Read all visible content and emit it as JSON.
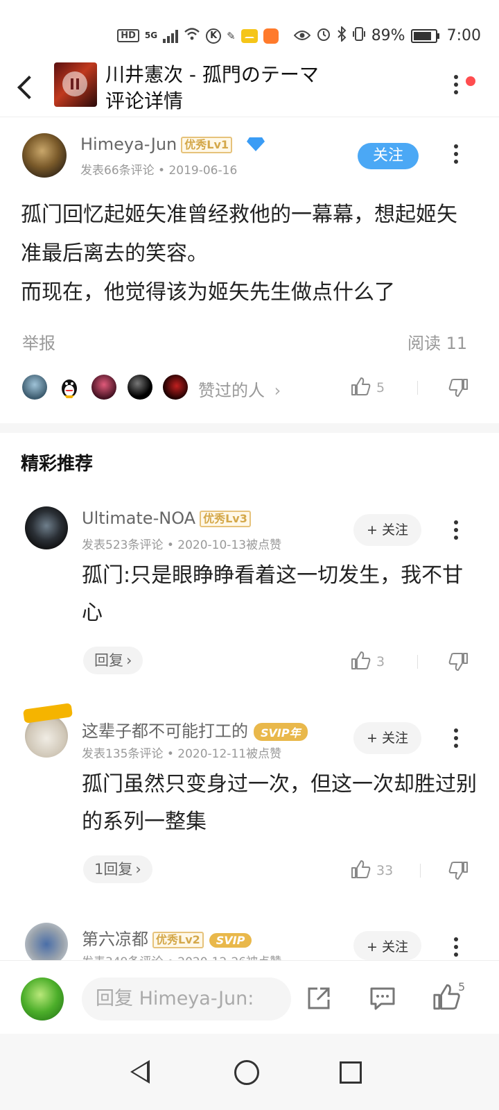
{
  "status_bar": {
    "hd": "HD",
    "network": "5G",
    "battery_pct_text": "89%",
    "battery_level": 0.89,
    "time": "7:00",
    "icons": [
      "hd-icon",
      "signal-icon",
      "wifi-icon",
      "k-icon",
      "app-icon",
      "mail-icon",
      "didi-icon",
      "eye-icon",
      "alarm-icon",
      "bluetooth-icon",
      "vibrate-icon",
      "battery-icon"
    ]
  },
  "header": {
    "song_title": "川井憲次 - 孤門のテーマ",
    "subtitle": "评论详情"
  },
  "main_comment": {
    "username": "Himeya-Jun",
    "level_badge": "优秀Lv1",
    "meta": "发表66条评论 • 2019-06-16",
    "follow_label": "关注",
    "text": "孤门回忆起姬矢准曾经救他的一幕幕，想起姬矢准最后离去的笑容。\n而现在，他觉得该为姬矢先生做点什么了",
    "report_label": "举报",
    "reads_label": "阅读 11",
    "likers_label": "赞过的人",
    "like_count": "5"
  },
  "section_title": "精彩推荐",
  "comments": [
    {
      "username": "Ultimate-NOA",
      "badge": "优秀Lv3",
      "meta": "发表523条评论 • 2020-10-13被点赞",
      "follow_label": "+ 关注",
      "text": "孤门:只是眼睁睁看着这一切发生，我不甘心",
      "reply_label": "回复",
      "like_count": "3"
    },
    {
      "username": "这辈子都不可能打工的",
      "badge": "SVIP年",
      "meta": "发表135条评论 • 2020-12-11被点赞",
      "follow_label": "+ 关注",
      "text": "孤门虽然只变身过一次，但这一次却胜过别的系列一整集",
      "reply_label": "1回复",
      "like_count": "33"
    },
    {
      "username": "第六凉都",
      "badge": "优秀Lv2",
      "badge2": "SVIP",
      "meta": "发表349条评论 • 2020-12-26被点赞",
      "follow_label": "+ 关注"
    }
  ],
  "bottom_bar": {
    "reply_placeholder": "回复 Himeya-Jun:",
    "like_count": "5"
  },
  "colors": {
    "accent_blue": "#4ba8f5",
    "badge_gold": "#e9b84b",
    "notification_red": "#ff4d4f"
  }
}
